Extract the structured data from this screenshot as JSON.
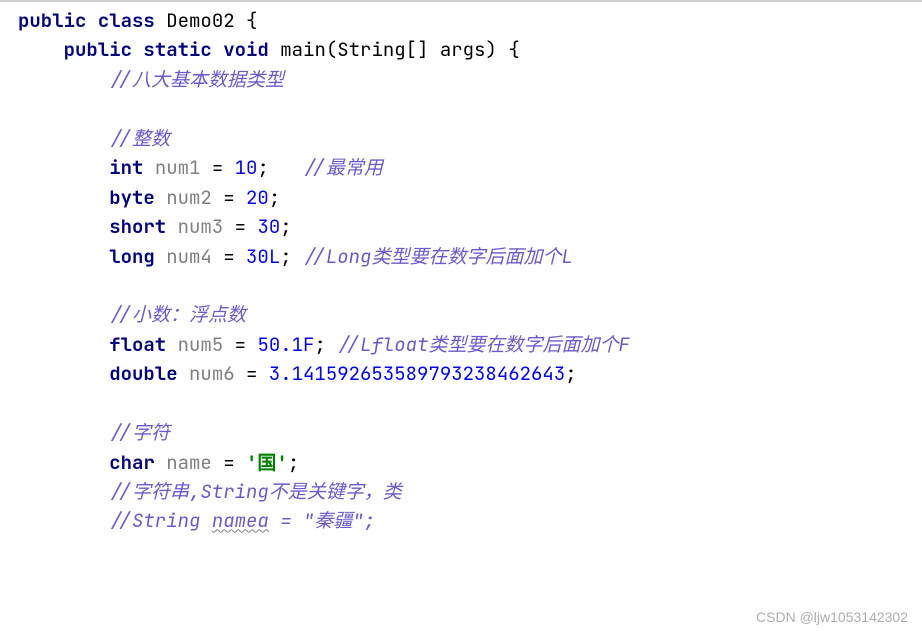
{
  "line1": {
    "kw1": "public",
    "kw2": "class",
    "name": "Demo02",
    "brace": " {"
  },
  "line2": {
    "kw1": "public",
    "kw2": "static",
    "kw3": "void",
    "method": "main",
    "params": "(String[] args) {"
  },
  "comments": {
    "c1": "//八大基本数据类型",
    "c2": "//整数",
    "c3": "//最常用",
    "c4": "//Long类型要在数字后面加个L",
    "c5": "//小数：浮点数",
    "c6": "//Lfloat类型要在数字后面加个F",
    "c7": "//字符",
    "c8": "//字符串,String不是关键字，类",
    "c9": "//String ",
    "c9_name": "namea",
    "c9_rest": " = \"秦疆\";"
  },
  "decls": {
    "int_kw": "int",
    "int_var": "num1",
    "int_val": "10",
    "byte_kw": "byte",
    "byte_var": "num2",
    "byte_val": "20",
    "short_kw": "short",
    "short_var": "num3",
    "short_val": "30",
    "long_kw": "long",
    "long_var": "num4",
    "long_val": "30L",
    "float_kw": "float",
    "float_var": "num5",
    "float_val": "50.1F",
    "double_kw": "double",
    "double_var": "num6",
    "double_val": "3.141592653589793238462643",
    "char_kw": "char",
    "char_var": "name",
    "char_val": "'国'"
  },
  "punct": {
    "eq": " = ",
    "semi": ";"
  },
  "watermark": "CSDN @ljw1053142302"
}
